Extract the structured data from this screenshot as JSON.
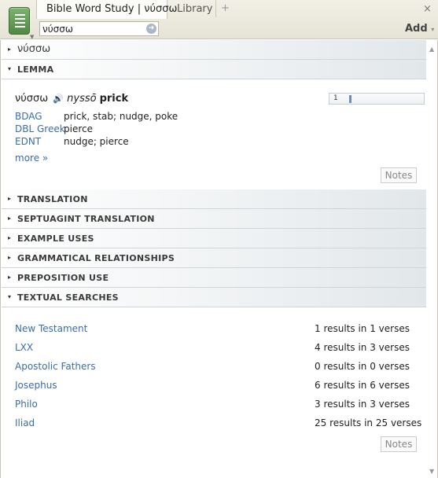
{
  "tabs": {
    "active_label": "Bible Word Study | νύσσω",
    "library_label": "Library",
    "new_tab": "+",
    "close": "×"
  },
  "toolbar": {
    "search_value": "νύσσω",
    "add_label": "Add",
    "add_caret": "▾"
  },
  "sections": {
    "word": "νύσσω",
    "lemma": "LEMMA",
    "translation": "TRANSLATION",
    "septuagint": "SEPTUAGINT TRANSLATION",
    "example_uses": "EXAMPLE USES",
    "grammatical": "GRAMMATICAL RELATIONSHIPS",
    "preposition": "PREPOSITION USE",
    "textual_searches": "TEXTUAL SEARCHES",
    "collapsed_glyph": "▸",
    "expanded_glyph": "▾"
  },
  "lemma": {
    "greek": "νύσσω",
    "transliteration": "nyssō",
    "gloss": "prick",
    "occurrences": "1",
    "occurrence_fill": 0.02,
    "definitions": [
      {
        "source": "BDAG",
        "text": "prick, stab; nudge, poke"
      },
      {
        "source": "DBL Greek",
        "text": "pierce"
      },
      {
        "source": "EDNT",
        "text": "nudge; pierce"
      }
    ],
    "more": "more »",
    "notes": "Notes"
  },
  "textual_searches": {
    "rows": [
      {
        "corpus": "New Testament",
        "results": "1 results in 1 verses"
      },
      {
        "corpus": "LXX",
        "results": "4 results in 3 verses"
      },
      {
        "corpus": "Apostolic Fathers",
        "results": "0 results in 0 verses"
      },
      {
        "corpus": "Josephus",
        "results": "6 results in 6 verses"
      },
      {
        "corpus": "Philo",
        "results": "3 results in 3 verses"
      },
      {
        "corpus": "Iliad",
        "results": "25 results in 25 verses"
      }
    ],
    "notes": "Notes"
  },
  "colors": {
    "link": "#3b6ea8",
    "menu_green": "#5a9650",
    "count_fill": "#6f8fb3"
  }
}
